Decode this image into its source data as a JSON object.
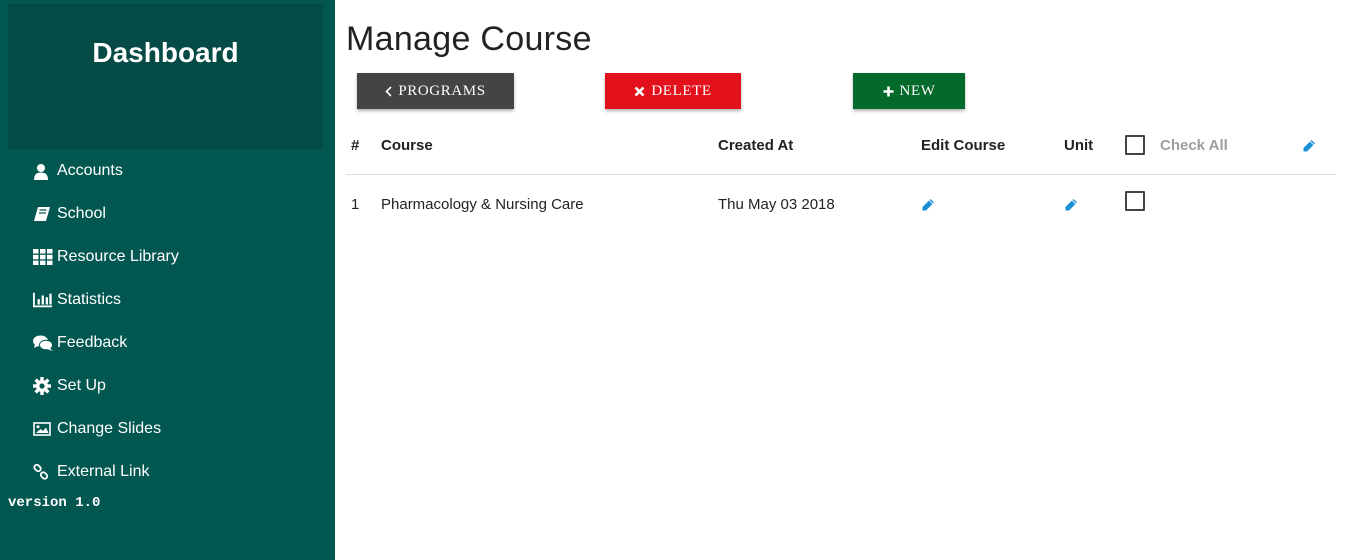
{
  "sidebar": {
    "title": "Dashboard",
    "items": [
      {
        "label": "Accounts",
        "icon": "user-icon"
      },
      {
        "label": "School",
        "icon": "book-icon"
      },
      {
        "label": "Resource Library",
        "icon": "grid-icon"
      },
      {
        "label": "Statistics",
        "icon": "bar-chart-icon"
      },
      {
        "label": "Feedback",
        "icon": "comments-icon"
      },
      {
        "label": "Set Up",
        "icon": "gear-icon"
      },
      {
        "label": "Change Slides",
        "icon": "image-icon"
      },
      {
        "label": "External Link",
        "icon": "link-icon"
      }
    ],
    "version": "version 1.0"
  },
  "main": {
    "title": "Manage Course",
    "toolbar": {
      "programs_label": "PROGRAMS",
      "delete_label": "DELETE",
      "new_label": "NEW"
    },
    "table": {
      "headers": {
        "index": "#",
        "course": "Course",
        "created_at": "Created At",
        "edit_course": "Edit Course",
        "unit": "Unit",
        "check_all": "Check All"
      },
      "rows": [
        {
          "index": "1",
          "course": "Pharmacology & Nursing Care",
          "created_at": "Thu May 03 2018"
        }
      ]
    }
  },
  "colors": {
    "sidebar_bg": "#035751",
    "sidebar_header_bg": "#044b45",
    "programs_button": "#444444",
    "delete_button": "#e2111b",
    "new_button": "#046a2b",
    "pencil_icon": "#1a8fd6"
  }
}
